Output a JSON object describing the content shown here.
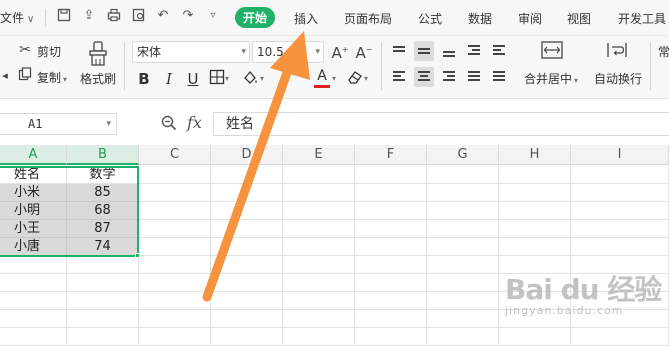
{
  "menubar": {
    "file_label": "文件",
    "tabs": [
      {
        "label": "开始",
        "active": true
      },
      {
        "label": "插入"
      },
      {
        "label": "页面布局"
      },
      {
        "label": "公式"
      },
      {
        "label": "数据"
      },
      {
        "label": "审阅"
      },
      {
        "label": "视图"
      },
      {
        "label": "开发工具"
      }
    ]
  },
  "ribbon": {
    "cut_label": "剪切",
    "copy_label": "复制",
    "format_painter_label": "格式刷",
    "font_name": "宋体",
    "font_size": "10.5",
    "merge_center_label": "合并居中",
    "wrap_text_label": "自动换行",
    "more_label": "常"
  },
  "formula_bar": {
    "cell_ref": "A1",
    "fx_label": "fx",
    "content": "姓名"
  },
  "sheet": {
    "columns": [
      "A",
      "B",
      "C",
      "D",
      "E",
      "F",
      "G",
      "H",
      "I"
    ],
    "rows": [
      [
        "姓名",
        "数学"
      ],
      [
        "小米",
        "85"
      ],
      [
        "小明",
        "68"
      ],
      [
        "小王",
        "87"
      ],
      [
        "小唐",
        "74"
      ]
    ]
  },
  "colors": {
    "accent": "#1fb167",
    "annotation_arrow": "#f7923d",
    "selection_fill": "#d9d9d9"
  },
  "watermark": {
    "main": "Bai du 经验",
    "sub": "jingyan.baidu.com"
  }
}
